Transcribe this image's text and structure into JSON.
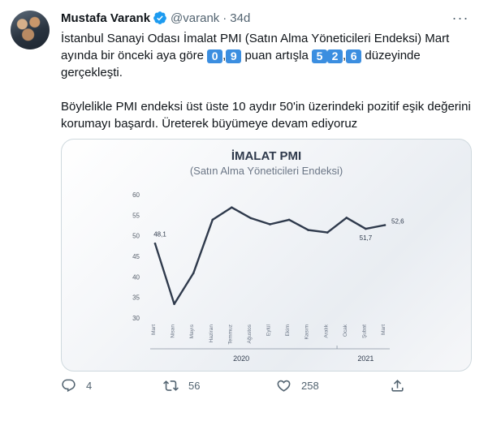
{
  "tweet": {
    "author_name": "Mustafa Varank",
    "handle": "@varank",
    "separator": "·",
    "time": "34d",
    "more_label": "···",
    "line1": "İstanbul Sanayi Odası İmalat PMI (Satın Alma Yöneticileri Endeksi) Mart",
    "line2_pre": "ayında bir önceki aya göre ",
    "digit_a": "0",
    "comma_a": ",",
    "digit_b": "9",
    "line2_mid": " puan artışla ",
    "digit_c": "5",
    "digit_d": "2",
    "comma_b": ",",
    "digit_e": "6",
    "line2_post": " düzeyinde",
    "line3": "gerçekleşti.",
    "paragraph2": "Böylelikle PMI endeksi üst üste 10 aydır 50'in üzerindeki pozitif eşik değerini korumayı başardı. Üreterek büyümeye devam ediyoruz"
  },
  "actions": {
    "reply_count": "4",
    "retweet_count": "56",
    "like_count": "258",
    "icons": [
      "reply-icon",
      "retweet-icon",
      "like-icon",
      "share-icon"
    ]
  },
  "colors": {
    "accent": "#1d9bf0",
    "chart_line": "#2f3a4c",
    "digit_box": "#3b8ee0"
  },
  "chart_data": {
    "type": "line",
    "title": "İMALAT PMI",
    "subtitle": "(Satın Alma Yöneticileri Endeksi)",
    "categories": [
      "Mart",
      "Nisan",
      "Mayıs",
      "Haziran",
      "Temmuz",
      "Ağustos",
      "Eylül",
      "Ekim",
      "Kasım",
      "Aralık",
      "Ocak",
      "Şubat",
      "Mart"
    ],
    "values": [
      48.1,
      33.4,
      40.9,
      53.9,
      56.9,
      54.3,
      52.8,
      53.9,
      51.4,
      50.8,
      54.4,
      51.7,
      52.6
    ],
    "data_labels": [
      {
        "index": 0,
        "text": "48,1"
      },
      {
        "index": 11,
        "text": "51,7"
      },
      {
        "index": 12,
        "text": "52,6"
      }
    ],
    "y_ticks": [
      "60",
      "55",
      "50",
      "45",
      "40",
      "35",
      "30"
    ],
    "ylim": [
      30,
      60
    ],
    "year_labels": [
      {
        "text": "2020",
        "from": 0,
        "to": 9
      },
      {
        "text": "2021",
        "from": 10,
        "to": 12
      }
    ],
    "grid": false
  }
}
